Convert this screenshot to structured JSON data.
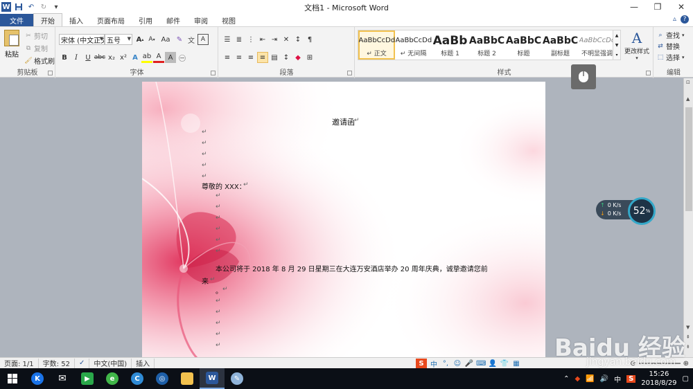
{
  "window": {
    "title": "文档1 - Microsoft Word"
  },
  "quick_access": {
    "undo_icon": "undo-icon",
    "redo_icon": "redo-icon",
    "save_icon": "save-icon"
  },
  "tabs": [
    "文件",
    "开始",
    "插入",
    "页面布局",
    "引用",
    "邮件",
    "审阅",
    "视图"
  ],
  "ribbon": {
    "clipboard": {
      "label": "剪贴板",
      "paste": "粘贴",
      "cut": "剪切",
      "copy": "复制",
      "format_painter": "格式刷"
    },
    "font": {
      "label": "字体",
      "font_name": "宋体 (中文正文)",
      "font_size": "五号",
      "bold": "B",
      "italic": "I",
      "underline": "U",
      "grow": "A",
      "shrink": "A",
      "case": "Aa"
    },
    "paragraph": {
      "label": "段落"
    },
    "styles": {
      "label": "样式",
      "items": [
        {
          "sample": "AaBbCcDd",
          "name": "↵ 正文"
        },
        {
          "sample": "AaBbCcDd",
          "name": "↵ 无间隔"
        },
        {
          "sample": "AaBb",
          "name": "标题 1"
        },
        {
          "sample": "AaBbC",
          "name": "标题 2"
        },
        {
          "sample": "AaBbC",
          "name": "标题"
        },
        {
          "sample": "AaBbC",
          "name": "副标题"
        },
        {
          "sample": "AaBbCcDd",
          "name": "不明显强调"
        }
      ],
      "change_styles": "更改样式"
    },
    "editing": {
      "label": "编辑",
      "find": "查找",
      "replace": "替换",
      "select": "选择"
    }
  },
  "document": {
    "title": "邀请函",
    "salutation": "尊敬的 XXX：",
    "body_line1": "本公司将于 2018 年 8 月 29 日星期三在大连万安酒店举办 20 周年庆典，诚挚邀请您前",
    "body_line2": "来",
    "body_line3": "。",
    "para_mark": "↵"
  },
  "speed_widget": {
    "up": "0 K/s",
    "down": "0 K/s",
    "percent": "52",
    "unit": "%"
  },
  "status_bar": {
    "page": "页面: 1/1",
    "words": "字数: 52",
    "language": "中文(中国)",
    "mode": "插入"
  },
  "ime": {
    "label": "中"
  },
  "watermark": {
    "brand": "Baidu 经验",
    "url": "jingyan.baidu.com"
  },
  "taskbar": {
    "tray_ime": "中",
    "time": "15:26",
    "date": "2018/8/29"
  },
  "colors": {
    "accent": "#2b579a",
    "file_tab": "#2b579a",
    "style_highlight": "#f2c14e",
    "taskbar": "#0b0f16"
  }
}
